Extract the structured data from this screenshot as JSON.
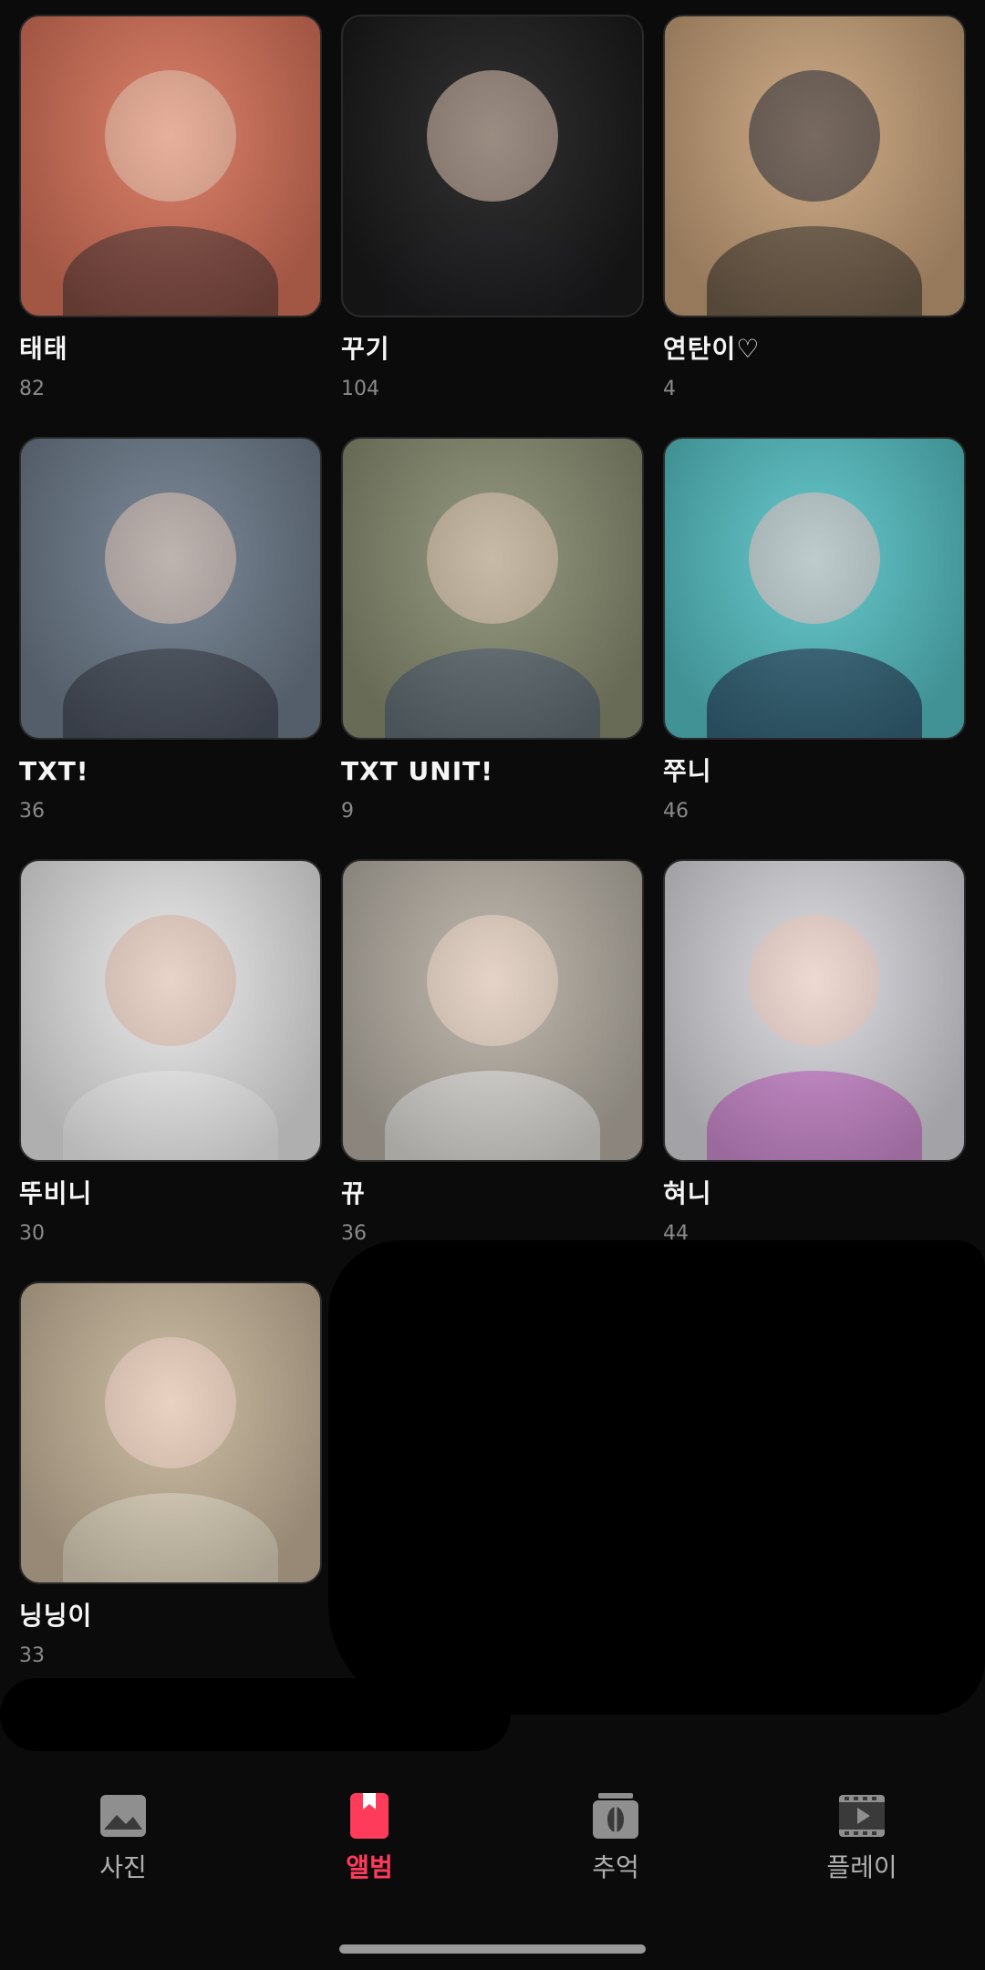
{
  "albums": [
    {
      "name": "태태",
      "count": "82",
      "bg": "#d8735a"
    },
    {
      "name": "꾸기",
      "count": "104",
      "bg": "#1b1b1b"
    },
    {
      "name": "연탄이♡",
      "count": "4",
      "bg": "#c8a27a"
    },
    {
      "name": "TXT!",
      "count": "36",
      "bg": "#6f7d8d"
    },
    {
      "name": "TXT UNIT!",
      "count": "9",
      "bg": "#8a8f73"
    },
    {
      "name": "쭈니",
      "count": "46",
      "bg": "#57c3c7"
    },
    {
      "name": "뚜비니",
      "count": "30",
      "bg": "#e9e9e9"
    },
    {
      "name": "뀨",
      "count": "36",
      "bg": "#b9b2a7"
    },
    {
      "name": "혀니",
      "count": "44",
      "bg": "#d9d9df"
    },
    {
      "name": "닝닝이",
      "count": "33",
      "bg": "#c9b79c"
    }
  ],
  "nav": {
    "photos": "사진",
    "albums": "앨범",
    "memories": "추억",
    "play": "플레이"
  },
  "colors": {
    "accent": "#ff3b5c",
    "background": "#0b0b0c"
  }
}
